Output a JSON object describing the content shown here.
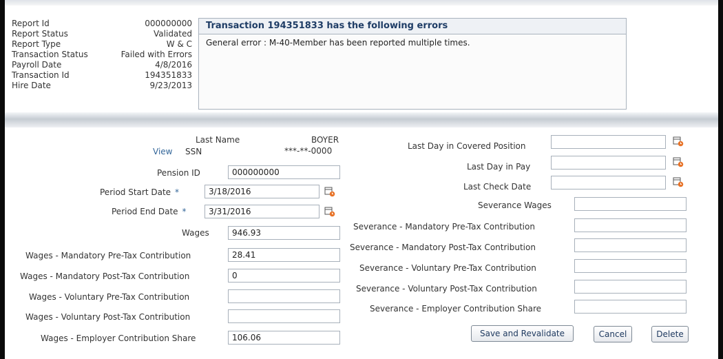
{
  "report_info": {
    "labels": [
      "Report Id",
      "Report Status",
      "Report Type",
      "Transaction Status",
      "Payroll Date",
      "Transaction Id",
      "Hire Date"
    ],
    "values": [
      "000000000",
      "Validated",
      "W & C",
      "Failed with Errors",
      "4/8/2016",
      "194351833",
      "9/23/2013"
    ]
  },
  "errors": {
    "title": "Transaction 194351833 has the following errors",
    "message": "General error : M-40-Member has been reported multiple times."
  },
  "member": {
    "last_name_label": "Last Name",
    "last_name_value": "BOYER",
    "view_link": "View",
    "ssn_label": "SSN",
    "ssn_value": "***-**-0000"
  },
  "left_form": {
    "pension_id_label": "Pension ID",
    "pension_id_value": "000000000",
    "period_start_label": "Period Start Date",
    "period_start_value": "3/18/2016",
    "period_end_label": "Period End Date",
    "period_end_value": "3/31/2016",
    "required_marker": "*",
    "wages_label": "Wages",
    "wages_value": "946.93",
    "mand_pre_label": "Wages - Mandatory Pre-Tax Contribution",
    "mand_pre_value": "28.41",
    "mand_post_label": "Wages - Mandatory Post-Tax Contribution",
    "mand_post_value": "0",
    "vol_pre_label": "Wages - Voluntary Pre-Tax Contribution",
    "vol_pre_value": "",
    "vol_post_label": "Wages - Voluntary Post-Tax Contribution",
    "vol_post_value": "",
    "employer_label": "Wages - Employer Contribution Share",
    "employer_value": "106.06"
  },
  "right_form": {
    "last_day_covered_label": "Last Day in Covered Position",
    "last_day_covered_value": "",
    "last_day_pay_label": "Last Day in Pay",
    "last_day_pay_value": "",
    "last_check_label": "Last Check Date",
    "last_check_value": "",
    "sev_wages_label": "Severance Wages",
    "sev_wages_value": "",
    "sev_mand_pre_label": "Severance - Mandatory Pre-Tax Contribution",
    "sev_mand_pre_value": "",
    "sev_mand_post_label": "Severance - Mandatory Post-Tax Contribution",
    "sev_mand_post_value": "",
    "sev_vol_pre_label": "Severance - Voluntary Pre-Tax Contribution",
    "sev_vol_pre_value": "",
    "sev_vol_post_label": "Severance - Voluntary Post-Tax Contribution",
    "sev_vol_post_value": "",
    "sev_employer_label": "Severance - Employer Contribution Share",
    "sev_employer_value": ""
  },
  "buttons": {
    "save": "Save and Revalidate",
    "cancel": "Cancel",
    "delete": "Delete"
  },
  "icons": {
    "date_picker": "calendar-clock-icon"
  },
  "colors": {
    "accent": "#336699",
    "header_text": "#1f3d66"
  }
}
